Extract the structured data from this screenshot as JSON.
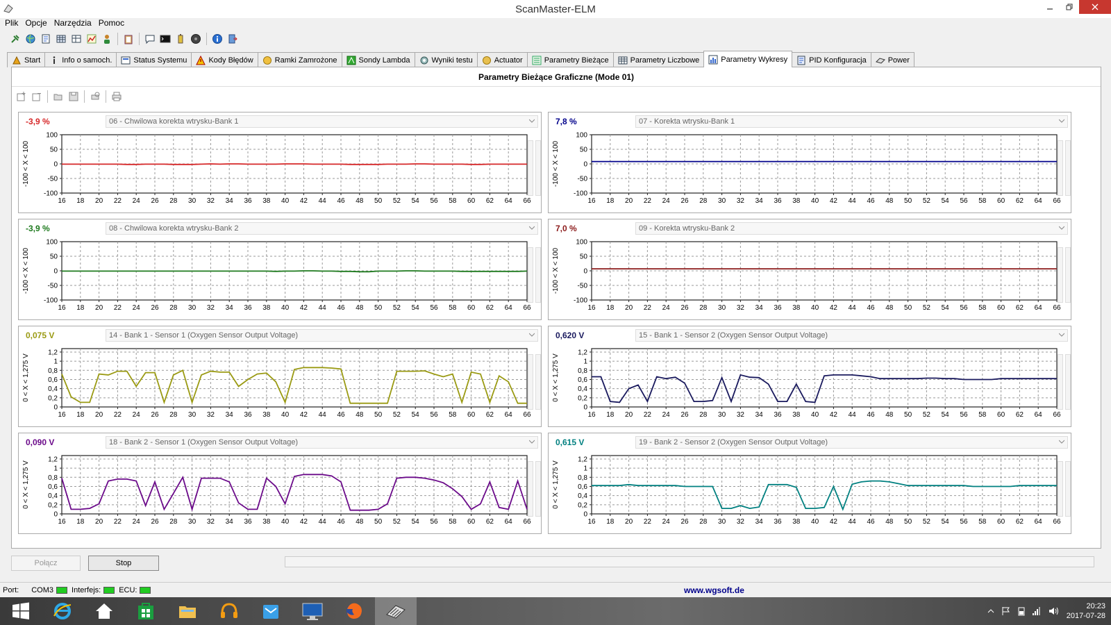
{
  "window": {
    "title": "ScanMaster-ELM"
  },
  "menu": [
    "Plik",
    "Opcje",
    "Narzędzia",
    "Pomoc"
  ],
  "tabs": [
    {
      "label": "Start",
      "icon": "start-icon"
    },
    {
      "label": "Info o samoch.",
      "icon": "info-icon"
    },
    {
      "label": "Status Systemu",
      "icon": "status-icon"
    },
    {
      "label": "Kody Błędów",
      "icon": "warning-icon"
    },
    {
      "label": "Ramki Zamrożone",
      "icon": "freeze-icon"
    },
    {
      "label": "Sondy Lambda",
      "icon": "lambda-icon"
    },
    {
      "label": "Wyniki testu",
      "icon": "gear-icon"
    },
    {
      "label": "Actuator",
      "icon": "actuator-icon"
    },
    {
      "label": "Parametry Bieżące",
      "icon": "list-icon"
    },
    {
      "label": "Parametry Liczbowe",
      "icon": "grid-icon"
    },
    {
      "label": "Parametry Wykresy",
      "icon": "chart-icon",
      "active": true
    },
    {
      "label": "PID Konfiguracja",
      "icon": "config-icon"
    },
    {
      "label": "Power",
      "icon": "power-icon"
    }
  ],
  "content": {
    "title": "Parametry Bieżące Graficzne (Mode 01)"
  },
  "charts": [
    {
      "value": "-3,9 %",
      "pid": "06 - Chwilowa korekta wtrysku-Bank 1",
      "color": "#d62728",
      "ylabel": "-100 < X < 100",
      "yticks": [
        "100",
        "50",
        "0",
        "-50",
        "-100"
      ],
      "ymin": -100,
      "ymax": 100,
      "y": [
        -1,
        -1,
        -1,
        -1,
        -1,
        -1,
        -1,
        -2,
        -2,
        -1,
        -1,
        -1,
        -2,
        -2,
        -2,
        -1,
        0,
        -1,
        0,
        0,
        -1,
        -1,
        -1,
        -1,
        0,
        0,
        0,
        -1,
        -1,
        -1,
        -1,
        -2,
        -2,
        -2,
        -2,
        -1,
        -1,
        -1,
        0,
        0,
        -1,
        -1,
        -1,
        -1,
        -2,
        -2,
        -1,
        -1,
        -1,
        -1,
        -1
      ]
    },
    {
      "value": "7,8 %",
      "pid": "07 - Korekta wtrysku-Bank 1",
      "color": "#00008b",
      "ylabel": "-100 < X < 100",
      "yticks": [
        "100",
        "50",
        "0",
        "-50",
        "-100"
      ],
      "ymin": -100,
      "ymax": 100,
      "y": [
        8,
        8,
        8,
        8,
        8,
        8,
        8,
        8,
        8,
        8,
        8,
        8,
        8,
        8,
        8,
        8,
        8,
        8,
        8,
        8,
        8,
        8,
        8,
        8,
        8,
        8,
        8,
        8,
        8,
        8,
        8,
        8,
        8,
        8,
        8,
        8,
        8,
        8,
        8,
        8,
        8,
        8,
        8,
        8,
        8,
        8,
        8,
        8,
        8,
        8,
        8
      ]
    },
    {
      "value": "-3,9 %",
      "pid": "08 - Chwilowa korekta wtrysku-Bank 2",
      "color": "#1e7a1e",
      "ylabel": "-100 < X < 100",
      "yticks": [
        "100",
        "50",
        "0",
        "-50",
        "-100"
      ],
      "ymin": -100,
      "ymax": 100,
      "y": [
        -1,
        -1,
        -1,
        -1,
        -1,
        -1,
        -1,
        -1,
        -1,
        -1,
        -1,
        -1,
        -1,
        -1,
        -1,
        -1,
        -1,
        -1,
        -1,
        -1,
        -1,
        -1,
        -1,
        -2,
        -1,
        -1,
        0,
        0,
        -1,
        -1,
        -2,
        -2,
        -3,
        -3,
        -1,
        -1,
        -1,
        0,
        0,
        -1,
        -1,
        -1,
        -1,
        -2,
        -2,
        -2,
        -2,
        -2,
        -2,
        -2,
        -1
      ]
    },
    {
      "value": "7,0 %",
      "pid": "09 - Korekta wtrysku-Bank 2",
      "color": "#8b1a1a",
      "ylabel": "-100 < X < 100",
      "yticks": [
        "100",
        "50",
        "0",
        "-50",
        "-100"
      ],
      "ymin": -100,
      "ymax": 100,
      "y": [
        7,
        7,
        7,
        7,
        7,
        7,
        7,
        7,
        7,
        7,
        7,
        7,
        7,
        7,
        7,
        7,
        7,
        7,
        7,
        7,
        7,
        7,
        7,
        7,
        7,
        7,
        7,
        7,
        7,
        7,
        7,
        7,
        7,
        7,
        7,
        7,
        7,
        7,
        7,
        7,
        7,
        7,
        7,
        7,
        7,
        7,
        7,
        7,
        7,
        7,
        7
      ]
    },
    {
      "value": "0,075 V",
      "pid": "14 - Bank 1 - Sensor 1 (Oxygen Sensor Output Voltage)",
      "color": "#9a9a12",
      "ylabel": "0 < X < 1,275 V",
      "yticks": [
        "1,2",
        "1",
        "0,8",
        "0,6",
        "0,4",
        "0,2",
        "0"
      ],
      "ymin": 0,
      "ymax": 1.275,
      "y": [
        0.72,
        0.22,
        0.1,
        0.1,
        0.72,
        0.7,
        0.78,
        0.78,
        0.45,
        0.75,
        0.75,
        0.1,
        0.7,
        0.8,
        0.1,
        0.7,
        0.78,
        0.76,
        0.76,
        0.45,
        0.6,
        0.72,
        0.74,
        0.55,
        0.1,
        0.82,
        0.86,
        0.86,
        0.86,
        0.85,
        0.83,
        0.08,
        0.08,
        0.08,
        0.08,
        0.08,
        0.78,
        0.78,
        0.78,
        0.79,
        0.72,
        0.66,
        0.72,
        0.1,
        0.76,
        0.72,
        0.1,
        0.68,
        0.55,
        0.08,
        0.08
      ]
    },
    {
      "value": "0,620 V",
      "pid": "15 - Bank 1 - Sensor 2 (Oxygen Sensor Output Voltage)",
      "color": "#1a1a5e",
      "ylabel": "0 < X < 1,275 V",
      "yticks": [
        "1,2",
        "1",
        "0,8",
        "0,6",
        "0,4",
        "0,2",
        "0"
      ],
      "ymin": 0,
      "ymax": 1.275,
      "y": [
        0.66,
        0.66,
        0.12,
        0.1,
        0.4,
        0.48,
        0.12,
        0.66,
        0.62,
        0.65,
        0.52,
        0.12,
        0.12,
        0.14,
        0.64,
        0.12,
        0.7,
        0.65,
        0.64,
        0.5,
        0.12,
        0.12,
        0.5,
        0.12,
        0.1,
        0.68,
        0.7,
        0.7,
        0.7,
        0.68,
        0.66,
        0.62,
        0.62,
        0.62,
        0.62,
        0.62,
        0.63,
        0.63,
        0.62,
        0.62,
        0.6,
        0.6,
        0.6,
        0.6,
        0.62,
        0.62,
        0.62,
        0.62,
        0.62,
        0.62,
        0.62
      ]
    },
    {
      "value": "0,090 V",
      "pid": "18 - Bank 2 - Sensor 1 (Oxygen Sensor Output Voltage)",
      "color": "#6b0a8a",
      "ylabel": "0 < X < 1,275 V",
      "yticks": [
        "1,2",
        "1",
        "0,8",
        "0,6",
        "0,4",
        "0,2",
        "0"
      ],
      "ymin": 0,
      "ymax": 1.275,
      "y": [
        0.78,
        0.1,
        0.1,
        0.12,
        0.22,
        0.72,
        0.76,
        0.76,
        0.72,
        0.18,
        0.7,
        0.1,
        0.45,
        0.8,
        0.1,
        0.78,
        0.78,
        0.78,
        0.7,
        0.24,
        0.1,
        0.1,
        0.78,
        0.6,
        0.22,
        0.82,
        0.86,
        0.86,
        0.86,
        0.83,
        0.7,
        0.08,
        0.08,
        0.08,
        0.1,
        0.22,
        0.78,
        0.8,
        0.8,
        0.78,
        0.74,
        0.68,
        0.55,
        0.38,
        0.1,
        0.22,
        0.7,
        0.14,
        0.1,
        0.72,
        0.1
      ]
    },
    {
      "value": "0,615 V",
      "pid": "19 - Bank 2 - Sensor 2 (Oxygen Sensor Output Voltage)",
      "color": "#008080",
      "ylabel": "0 < X < 1,275 V",
      "yticks": [
        "1,2",
        "1",
        "0,8",
        "0,6",
        "0,4",
        "0,2",
        "0"
      ],
      "ymin": 0,
      "ymax": 1.275,
      "y": [
        0.62,
        0.62,
        0.62,
        0.62,
        0.64,
        0.62,
        0.62,
        0.62,
        0.62,
        0.62,
        0.6,
        0.6,
        0.6,
        0.6,
        0.12,
        0.12,
        0.18,
        0.12,
        0.15,
        0.64,
        0.64,
        0.64,
        0.58,
        0.12,
        0.12,
        0.14,
        0.6,
        0.1,
        0.65,
        0.7,
        0.72,
        0.72,
        0.7,
        0.66,
        0.62,
        0.62,
        0.62,
        0.62,
        0.62,
        0.62,
        0.62,
        0.6,
        0.6,
        0.6,
        0.6,
        0.6,
        0.62,
        0.62,
        0.62,
        0.62,
        0.62
      ]
    }
  ],
  "xticks": [
    "16",
    "18",
    "20",
    "22",
    "24",
    "26",
    "28",
    "30",
    "32",
    "34",
    "36",
    "38",
    "40",
    "42",
    "44",
    "46",
    "48",
    "50",
    "52",
    "54",
    "56",
    "58",
    "60",
    "62",
    "64",
    "66"
  ],
  "xmin": 16,
  "xmax": 66,
  "buttons": {
    "connect": "Połącz",
    "stop": "Stop"
  },
  "status": {
    "port_label": "Port:",
    "port_value": "COM3",
    "interface_label": "Interfejs:",
    "ecu_label": "ECU:",
    "url": "www.wgsoft.de"
  },
  "tray": {
    "time": "20:23",
    "date": "2017-07-28"
  }
}
